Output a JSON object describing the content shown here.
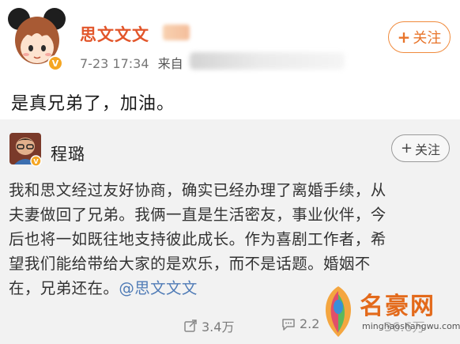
{
  "post": {
    "author": "思文文文",
    "time": "7-23 17:34",
    "source_prefix": "来自",
    "follow_label": "关注",
    "text": "是真兄弟了，加油。"
  },
  "repost": {
    "author": "程璐",
    "follow_label": "关注",
    "lines": [
      "我和思文经过友好协商，确实已经办理了离婚手续，从",
      "夫妻做回了兄弟。我俩一直是生活密友，事业伙伴，今",
      "后也将一如既往地支持彼此成长。作为喜剧工作者，希",
      "望我们能给带给大家的是欢乐，而不是话题。婚姻不"
    ],
    "last_line_prefix": "在，兄弟还在。",
    "mention": "@思文文文",
    "actions": {
      "share_count": "3.4万",
      "comment_count": "2.2",
      "like_count": "36.6万"
    }
  },
  "watermark": {
    "title": "名豪网",
    "url": "minghaoshangwu.com"
  },
  "colors": {
    "author_name": "#e2562b",
    "follow_accent": "#f08a3c",
    "mention": "#4f7bb6",
    "repost_bg": "#f2f2f2"
  },
  "icons": [
    "avatar-cartoon-girl",
    "verified-badge",
    "plus-icon",
    "share-icon",
    "comment-icon",
    "like-icon",
    "watermark-logo"
  ]
}
